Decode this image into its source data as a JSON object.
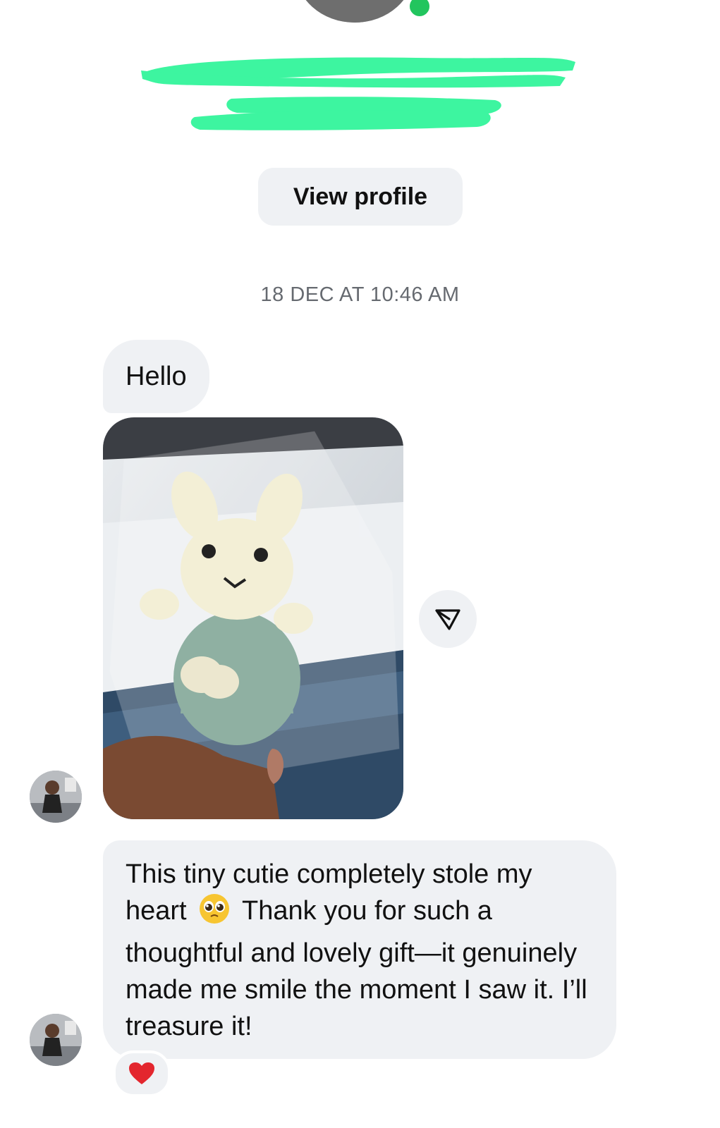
{
  "header": {
    "view_profile_label": "View profile",
    "online_color": "#22c55e",
    "redaction_color": "#3df5a0"
  },
  "conversation": {
    "timestamp": "18 DEC AT 10:46 AM",
    "messages": [
      {
        "text": "Hello"
      },
      {
        "attachment": "photo"
      },
      {
        "text_part1": "This tiny cutie completely stole my heart",
        "emoji": "pleading-face-icon",
        "text_part2": "Thank you for such a thoughtful and lovely gift—it genuinely made me smile the moment I saw it. I’ll treasure it!"
      }
    ],
    "reaction": "heart-icon"
  },
  "colors": {
    "bubble_bg": "#eff1f4",
    "timestamp_text": "#666a70"
  }
}
